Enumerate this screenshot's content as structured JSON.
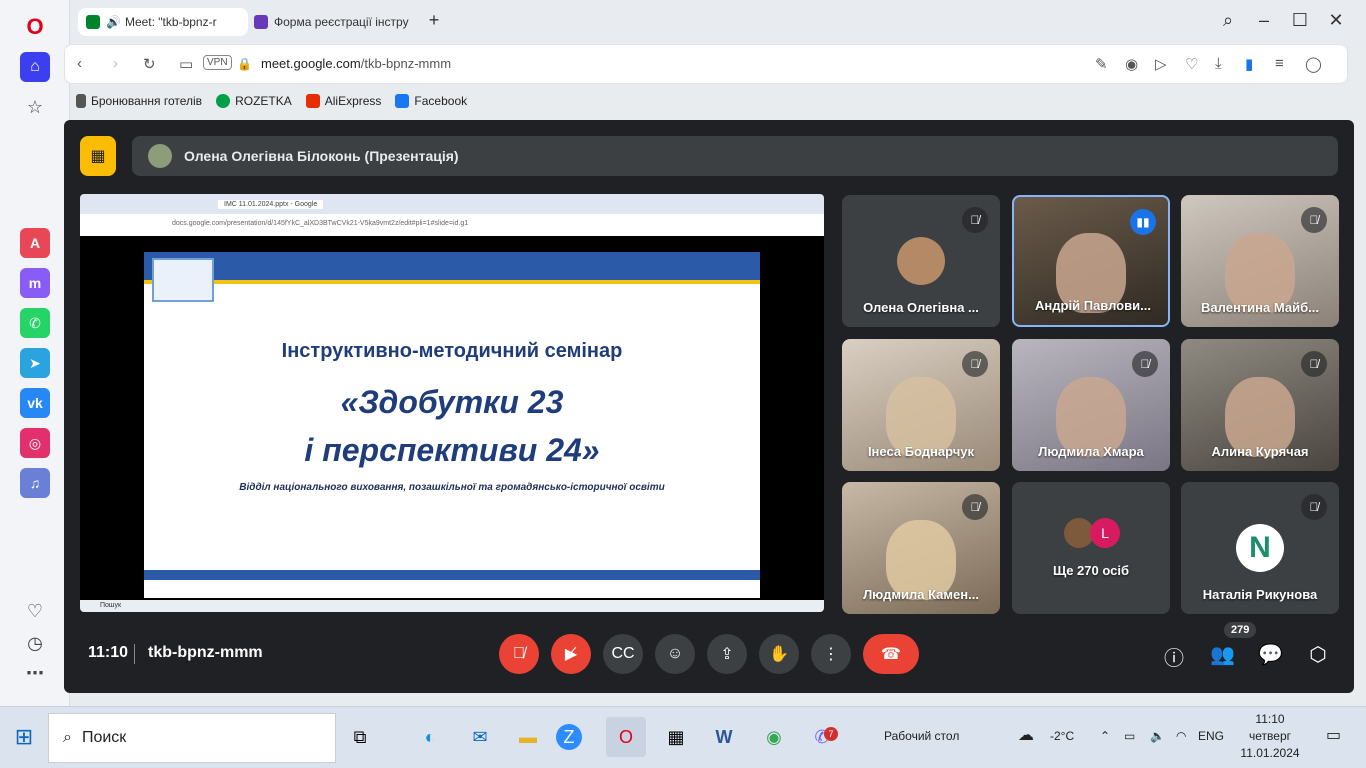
{
  "browser": {
    "tabs": [
      {
        "label": "Meet: \"tkb-bpnz-r",
        "active": true
      },
      {
        "label": "Форма реєстрації інстру",
        "active": false
      }
    ],
    "new_tab": "+",
    "url_domain": "meet.google.com",
    "url_path": "/tkb-bpnz-mmm",
    "vpn": "VPN",
    "bookmarks": [
      {
        "label": "Бронювання готелів",
        "icon": "bookmark-icon"
      },
      {
        "label": "ROZETKA",
        "icon": "rozetka-icon"
      },
      {
        "label": "AliExpress",
        "icon": "aliexpress-icon"
      },
      {
        "label": "Facebook",
        "icon": "facebook-icon"
      }
    ]
  },
  "meet": {
    "presenter": "Олена Олегівна Білоконь (Презентація)",
    "slide": {
      "heading": "Інструктивно-методичний семінар",
      "title_line1": "«Здобутки 23",
      "title_line2": "і перспективи 24»",
      "subtitle": "Відділ національного виховання, позашкільної та громадянсько-історичної освіти"
    },
    "inner_browser": {
      "address": "docs.google.com/presentation/d/145fYkC_alXD3BTwCVk21-V5ka9vmt2z/edit#pli=1#slide=id.g1",
      "tab": "ІМС 11.01.2024.pptx - Google",
      "taskbar_search": "Пошук"
    },
    "participants": [
      {
        "name": "Олена Олегівна ...",
        "muted": true,
        "speaking": false,
        "type": "avatar"
      },
      {
        "name": "Андрій Павлови...",
        "muted": false,
        "speaking": true,
        "type": "camera"
      },
      {
        "name": "Валентина Майб...",
        "muted": true,
        "speaking": false,
        "type": "camera"
      },
      {
        "name": "Інеса Боднарчук",
        "muted": true,
        "speaking": false,
        "type": "camera"
      },
      {
        "name": "Людмила Хмара",
        "muted": true,
        "speaking": false,
        "type": "camera"
      },
      {
        "name": "Алина Курячая",
        "muted": true,
        "speaking": false,
        "type": "camera"
      },
      {
        "name": "Людмила Камен...",
        "muted": true,
        "speaking": false,
        "type": "camera"
      },
      {
        "name": "Ще 270 осіб",
        "muted": false,
        "speaking": false,
        "type": "others",
        "initial": "L"
      },
      {
        "name": "Наталія Рикунова",
        "muted": true,
        "speaking": false,
        "type": "letter",
        "initial": "N"
      }
    ],
    "time": "11:10",
    "meeting_code": "tkb-bpnz-mmm",
    "participant_count": "279",
    "colors": {
      "end_call": "#ea4335",
      "present_badge": "#fbbc04",
      "speaking": "#1a73e8"
    }
  },
  "taskbar": {
    "search_label": "Поиск",
    "desktop_label": "Рабочий стол",
    "weather_temp": "-2°C",
    "lang": "ENG",
    "clock_time": "11:10",
    "clock_day": "четверг",
    "clock_date": "11.01.2024",
    "viber_badge": "7"
  }
}
